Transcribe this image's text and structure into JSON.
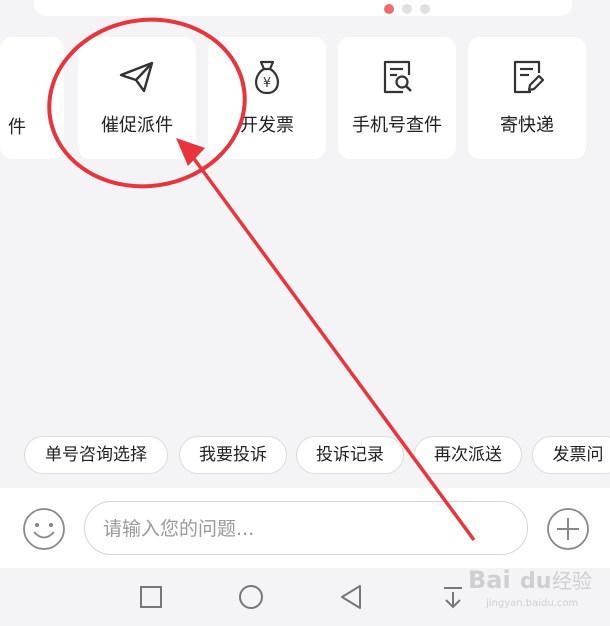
{
  "carousel": {
    "page_count": 3,
    "active_index": 0
  },
  "services": [
    {
      "label": "件",
      "icon": "partial-card"
    },
    {
      "label": "催促派件",
      "icon": "paper-plane-icon"
    },
    {
      "label": "开发票",
      "icon": "money-bag-icon"
    },
    {
      "label": "手机号查件",
      "icon": "document-search-icon"
    },
    {
      "label": "寄快递",
      "icon": "document-edit-icon"
    }
  ],
  "quick_replies": [
    "单号咨询选择",
    "我要投诉",
    "投诉记录",
    "再次派送",
    "发票问"
  ],
  "input": {
    "placeholder": "请输入您的问题..."
  },
  "system_nav": [
    "recent-apps-square-icon",
    "home-circle-icon",
    "back-triangle-icon",
    "notification-down-icon"
  ],
  "watermark": {
    "brand": "Bai",
    "brand_suffix": "du",
    "cn": "经验",
    "url": "jingyan.baidu.com"
  },
  "annotation": {
    "color": "#e8343a",
    "shape": "circle-with-arrow"
  }
}
